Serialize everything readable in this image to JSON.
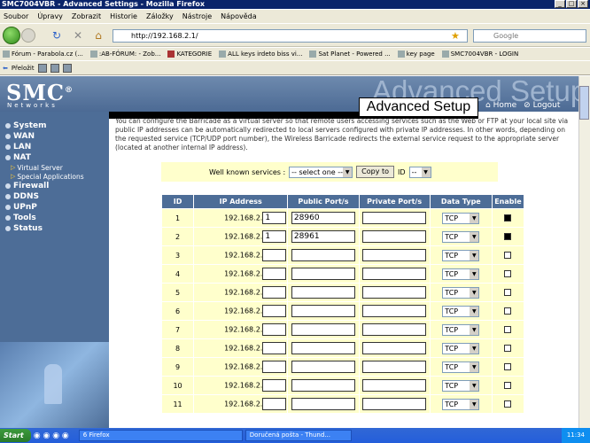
{
  "window": {
    "title": "SMC7004VBR - Advanced Settings - Mozilla Firefox"
  },
  "menu": [
    "Soubor",
    "Úpravy",
    "Zobrazit",
    "Historie",
    "Záložky",
    "Nástroje",
    "Nápověda"
  ],
  "nav": {
    "url": "http://192.168.2.1/",
    "search_placeholder": "Google"
  },
  "bookmarks": [
    "Fórum - Parabola.cz (...",
    ":AB-FÓRUM: - Zob...",
    "KATEGORIE",
    "ALL keys irdeto biss vi...",
    "Sat Planet - Powered ...",
    "key page",
    "SMC7004VBR - LOGIN"
  ],
  "toolbar2": {
    "translate_label": "Přeložit"
  },
  "router": {
    "logo": "SMC",
    "logo_reg": "®",
    "logo_sub": "Networks",
    "banner": "Advanced Setup",
    "page_title": "Advanced Setup",
    "home_link": "Home",
    "logout_link": "Logout",
    "sidebar": [
      {
        "label": "System"
      },
      {
        "label": "WAN"
      },
      {
        "label": "LAN"
      },
      {
        "label": "NAT",
        "sub": [
          "Virtual Server",
          "Special Applications"
        ]
      },
      {
        "label": "Firewall"
      },
      {
        "label": "DDNS"
      },
      {
        "label": "UPnP"
      },
      {
        "label": "Tools"
      },
      {
        "label": "Status"
      }
    ],
    "intro": "You can configure the Barricade as a virtual server so that remote users accessing services such as the Web or FTP at your local site via public IP addresses can be automatically redirected to local servers configured with private IP addresses. In other words, depending on the requested service (TCP/UDP port number), the Wireless Barricade redirects the external service request to the appropriate server (located at another internal IP address).",
    "well_known_label": "Well known services :",
    "well_known_select": "-- select one --",
    "copy_button": "Copy to",
    "id_label": "ID",
    "id_select": "--",
    "table": {
      "headers": [
        "ID",
        "IP Address",
        "Public Port/s",
        "Private Port/s",
        "Data Type",
        "Enable"
      ],
      "ip_prefix": "192.168.2.",
      "rows": [
        {
          "id": "1",
          "ip": "1",
          "public": "28960",
          "private": "",
          "type": "TCP",
          "enabled": true
        },
        {
          "id": "2",
          "ip": "1",
          "public": "28961",
          "private": "",
          "type": "TCP",
          "enabled": true
        },
        {
          "id": "3",
          "ip": "",
          "public": "",
          "private": "",
          "type": "TCP",
          "enabled": false
        },
        {
          "id": "4",
          "ip": "",
          "public": "",
          "private": "",
          "type": "TCP",
          "enabled": false
        },
        {
          "id": "5",
          "ip": "",
          "public": "",
          "private": "",
          "type": "TCP",
          "enabled": false
        },
        {
          "id": "6",
          "ip": "",
          "public": "",
          "private": "",
          "type": "TCP",
          "enabled": false
        },
        {
          "id": "7",
          "ip": "",
          "public": "",
          "private": "",
          "type": "TCP",
          "enabled": false
        },
        {
          "id": "8",
          "ip": "",
          "public": "",
          "private": "",
          "type": "TCP",
          "enabled": false
        },
        {
          "id": "9",
          "ip": "",
          "public": "",
          "private": "",
          "type": "TCP",
          "enabled": false
        },
        {
          "id": "10",
          "ip": "",
          "public": "",
          "private": "",
          "type": "TCP",
          "enabled": false
        },
        {
          "id": "11",
          "ip": "",
          "public": "",
          "private": "",
          "type": "TCP",
          "enabled": false
        }
      ]
    }
  },
  "taskbar": {
    "start": "Start",
    "items": [
      "6 Firefox",
      "Doručená pošta - Thund..."
    ],
    "clock": "11:34"
  }
}
